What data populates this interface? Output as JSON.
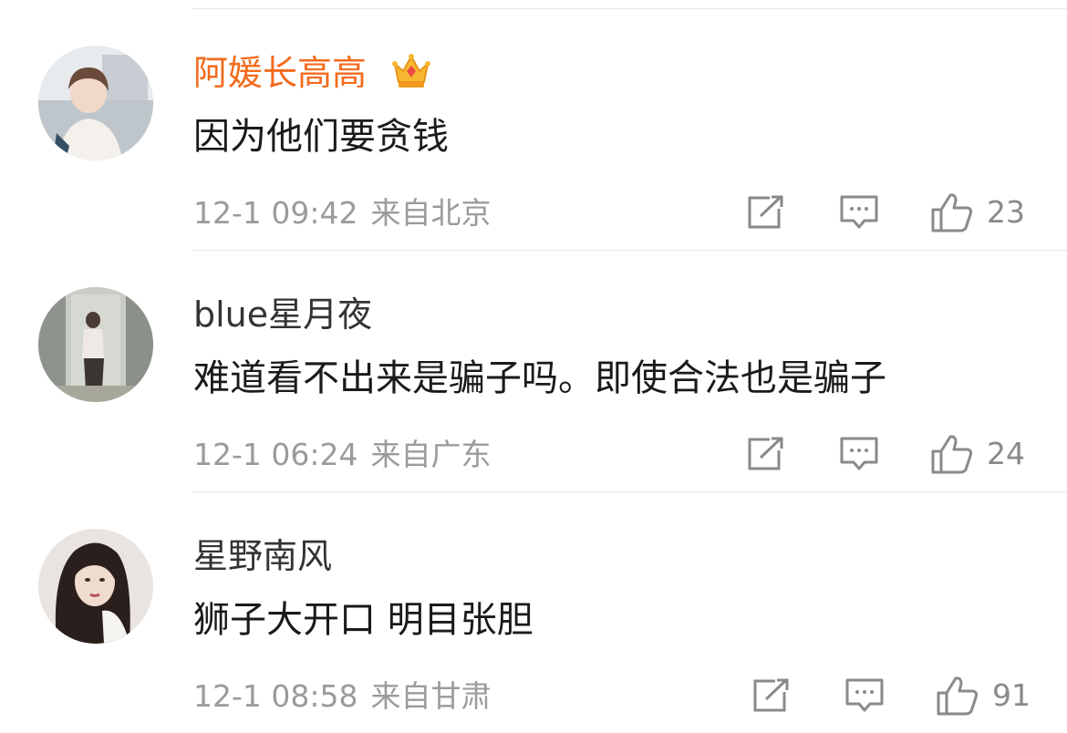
{
  "comments": [
    {
      "username": "阿媛长高高",
      "vip": true,
      "text": "因为他们要贪钱",
      "time": "12-1 09:42",
      "location": "来自北京",
      "likes": "23"
    },
    {
      "username": "blue星月夜",
      "vip": false,
      "text": "难道看不出来是骗子吗。即使合法也是骗子",
      "time": "12-1 06:24",
      "location": "来自广东",
      "likes": "24"
    },
    {
      "username": "星野南风",
      "vip": false,
      "text": "狮子大开口 明目张胆",
      "time": "12-1 08:58",
      "location": "来自甘肃",
      "likes": "91"
    }
  ],
  "icons": {
    "share": "share-icon",
    "comment": "comment-icon",
    "like": "thumbs-up-icon",
    "vip": "crown-icon"
  },
  "colors": {
    "vip_name": "#f26b1d",
    "name": "#333333",
    "meta": "#9b9b9b",
    "divider": "#e9e9e9"
  }
}
